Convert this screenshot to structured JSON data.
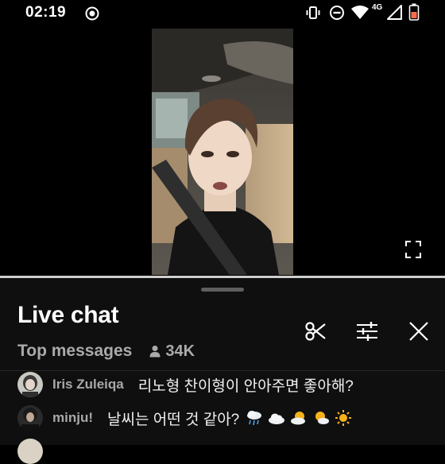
{
  "status_bar": {
    "time": "02:19",
    "network": "4G",
    "icons": [
      "screen-record-icon",
      "vibrate-icon",
      "do-not-disturb-icon",
      "wifi-icon",
      "signal-icon",
      "battery-low-icon"
    ]
  },
  "video": {
    "fullscreen_icon": "fullscreen-icon"
  },
  "chat": {
    "title": "Live chat",
    "filter_label": "Top messages",
    "viewer_count": "34K",
    "header_buttons": [
      "scissors-icon",
      "tune-icon",
      "close-icon"
    ],
    "messages": [
      {
        "author": "Iris Zuleiqa",
        "text": "리노형 찬이형이 안아주면 좋아해?"
      },
      {
        "author": "minju!",
        "text": "날씨는 어떤 것 같아?",
        "emojis": [
          "cloud-rain-icon",
          "cloud-icon",
          "sun-behind-cloud-icon",
          "sun-behind-small-cloud-icon",
          "sun-icon"
        ]
      }
    ]
  },
  "colors": {
    "panel_bg": "#0f0f0f",
    "secondary_text": "#aaaaaa",
    "author_text": "#a8a8a8",
    "battery_accent": "#ff6a4d"
  }
}
